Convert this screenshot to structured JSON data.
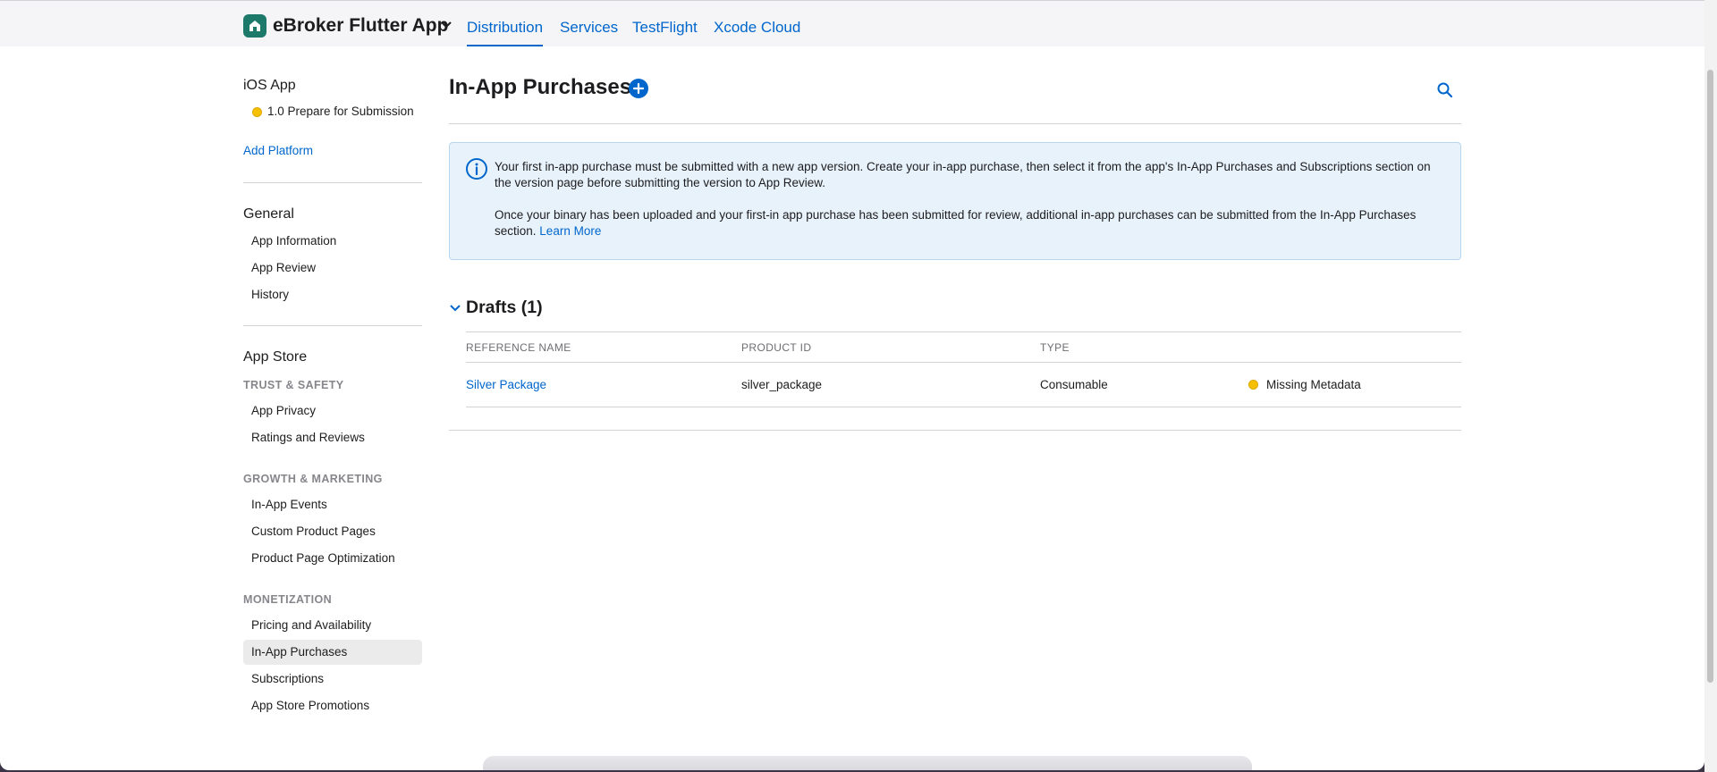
{
  "header": {
    "app_name": "eBroker Flutter App",
    "tabs": [
      {
        "label": "Distribution",
        "active": true
      },
      {
        "label": "Services"
      },
      {
        "label": "TestFlight"
      },
      {
        "label": "Xcode Cloud"
      }
    ]
  },
  "sidebar": {
    "platform_heading": "iOS App",
    "version_status": "1.0 Prepare for Submission",
    "add_platform": "Add Platform",
    "general_heading": "General",
    "general_items": [
      "App Information",
      "App Review",
      "History"
    ],
    "app_store_heading": "App Store",
    "trust_safety_label": "TRUST & SAFETY",
    "trust_safety_items": [
      "App Privacy",
      "Ratings and Reviews"
    ],
    "growth_label": "GROWTH & MARKETING",
    "growth_items": [
      "In-App Events",
      "Custom Product Pages",
      "Product Page Optimization"
    ],
    "monetization_label": "MONETIZATION",
    "monetization_items": [
      "Pricing and Availability",
      "In-App Purchases",
      "Subscriptions",
      "App Store Promotions"
    ],
    "selected_item": "In-App Purchases"
  },
  "main": {
    "title": "In-App Purchases",
    "info": {
      "paragraph1": "Your first in-app purchase must be submitted with a new app version. Create your in-app purchase, then select it from the app's In-App Purchases and Subscriptions section on the version page before submitting the version to App Review.",
      "paragraph2": "Once your binary has been uploaded and your first-in app purchase has been submitted for review, additional in-app purchases can be submitted from the In-App Purchases section.",
      "learn_more": "Learn More"
    },
    "drafts": {
      "title": "Drafts (1)",
      "columns": [
        "REFERENCE NAME",
        "PRODUCT ID",
        "TYPE"
      ],
      "rows": [
        {
          "reference_name": "Silver Package",
          "product_id": "silver_package",
          "type": "Consumable",
          "status": "Missing Metadata"
        }
      ]
    }
  },
  "colors": {
    "accent": "#0066cc",
    "status_warning": "#f5c000",
    "info_background": "#e8f2fb",
    "app_icon": "#1d7a6b"
  },
  "icons": [
    "app-icon",
    "chevron-down-icon",
    "plus-icon",
    "search-icon",
    "info-icon"
  ]
}
